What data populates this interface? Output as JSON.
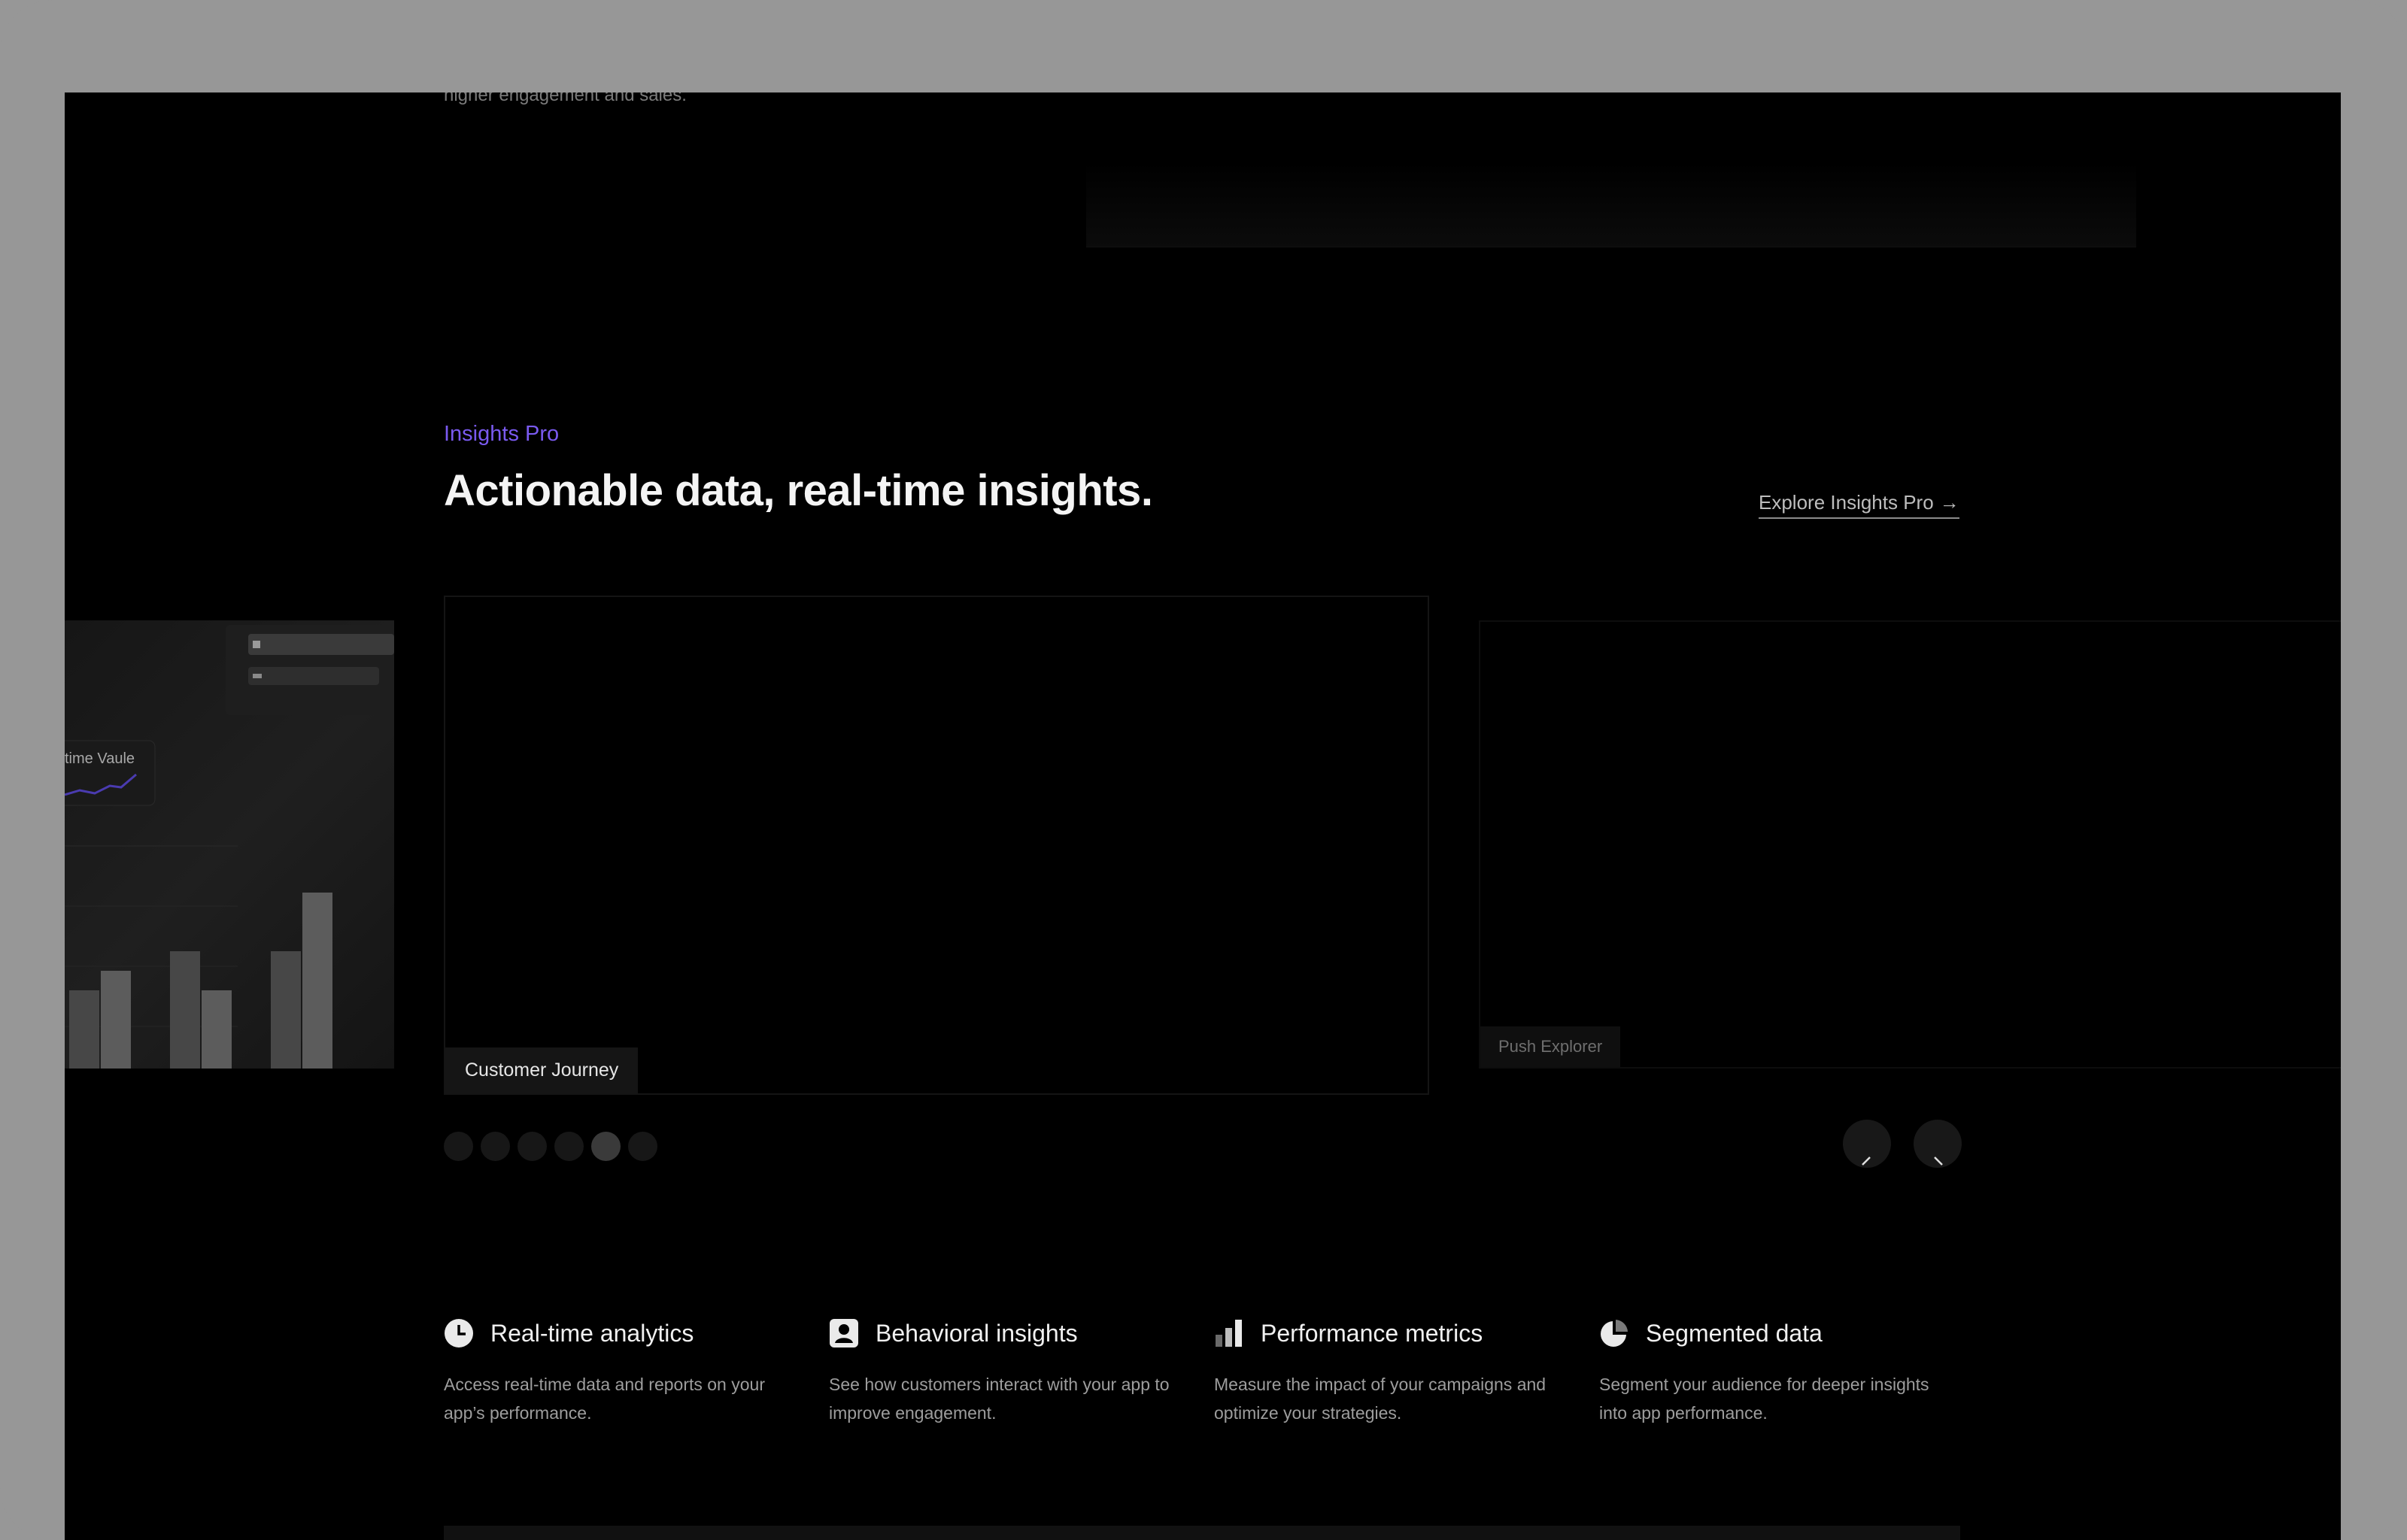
{
  "top": {
    "tagline": "higher engagement and sales."
  },
  "section": {
    "eyebrow": "Insights Pro",
    "headline": "Actionable data, real-time insights.",
    "explore_link": "Explore Insights Pro",
    "explore_arrow": "→"
  },
  "carousel": {
    "left_card_label": "time Vaule",
    "left_card_bars": [
      0.4,
      0.5,
      0.6,
      0.4,
      0.6,
      0.9
    ],
    "slides": [
      {
        "label": "Customer Journey"
      },
      {
        "label": "Push Explorer"
      }
    ],
    "dot_count": 6,
    "active_dot": 4,
    "prev_icon": "arrow-left-icon",
    "next_icon": "arrow-right-icon"
  },
  "features": [
    {
      "icon": "clock-icon",
      "title": "Real-time analytics",
      "desc": "Access real-time data and reports on your app’s performance."
    },
    {
      "icon": "user-card-icon",
      "title": "Behavioral insights",
      "desc": "See how customers interact with your app to improve engagement."
    },
    {
      "icon": "bar-chart-icon",
      "title": "Performance metrics",
      "desc": "Measure the impact of your campaigns and optimize your strategies."
    },
    {
      "icon": "pie-chart-icon",
      "title": "Segmented data",
      "desc": "Segment your audience for deeper insights into app performance."
    }
  ],
  "colors": {
    "accent": "#7a5af0",
    "background": "#000000",
    "bezel": "#979797"
  }
}
